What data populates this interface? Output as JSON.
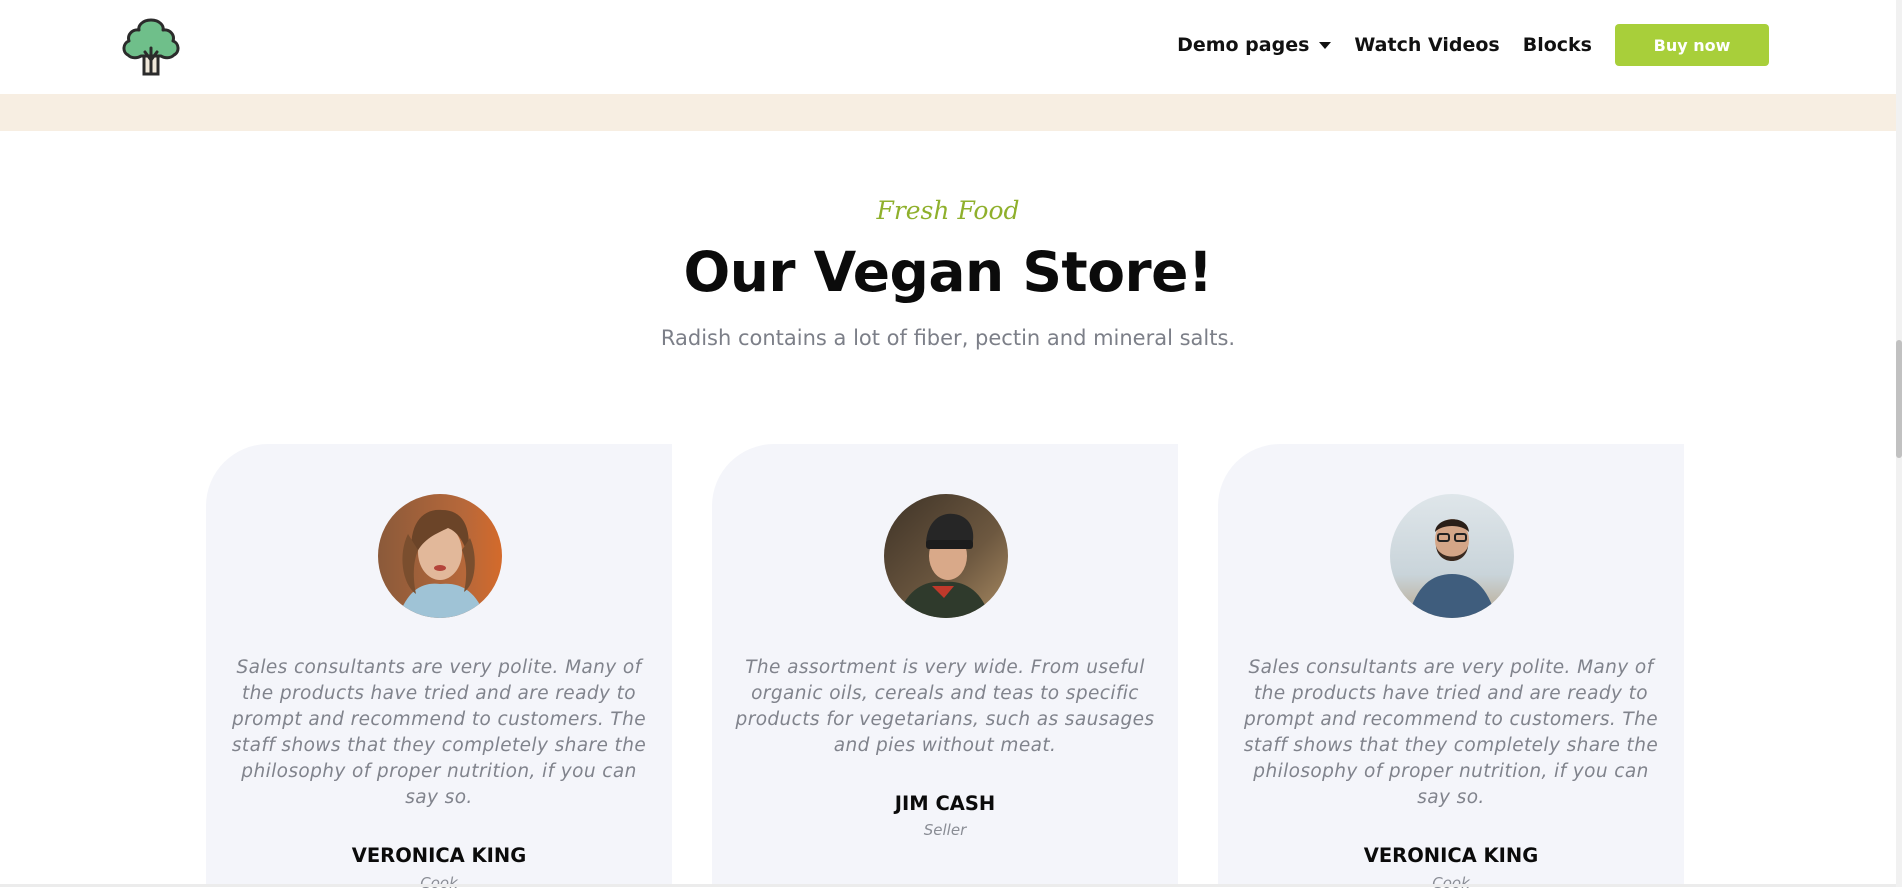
{
  "header": {
    "logo_icon": "broccoli-icon",
    "nav": {
      "demo_pages": "Demo pages",
      "watch_videos": "Watch Videos",
      "blocks": "Blocks"
    },
    "buy_button": "Buy now"
  },
  "colors": {
    "accent": "#a8cf3a",
    "eyebrow": "#8fb02c",
    "band": "#f7eee2",
    "card_bg": "#f4f5fa"
  },
  "section": {
    "eyebrow": "Fresh Food",
    "title": "Our Vegan Store!",
    "subtitle": "Radish contains a lot of fiber, pectin and mineral salts."
  },
  "testimonials": [
    {
      "quote": "Sales consultants are very polite. Many of the products have tried and are ready to prompt and recommend to customers. The staff shows that they completely share the philosophy of proper nutrition, if you can say so.",
      "name": "VERONICA KING",
      "role": "Cook",
      "avatar": "woman-portrait"
    },
    {
      "quote": "The assortment is very wide. From useful organic oils, cereals and teas to specific products for vegetarians, such as sausages and pies without meat.",
      "name": "JIM CASH",
      "role": "Seller",
      "avatar": "man-beanie-portrait"
    },
    {
      "quote": "Sales consultants are very polite. Many of the products have tried and are ready to prompt and recommend to customers. The staff shows that they completely share the philosophy of proper nutrition, if you can say so.",
      "name": "VERONICA KING",
      "role": "Cook",
      "avatar": "man-glasses-portrait"
    }
  ]
}
